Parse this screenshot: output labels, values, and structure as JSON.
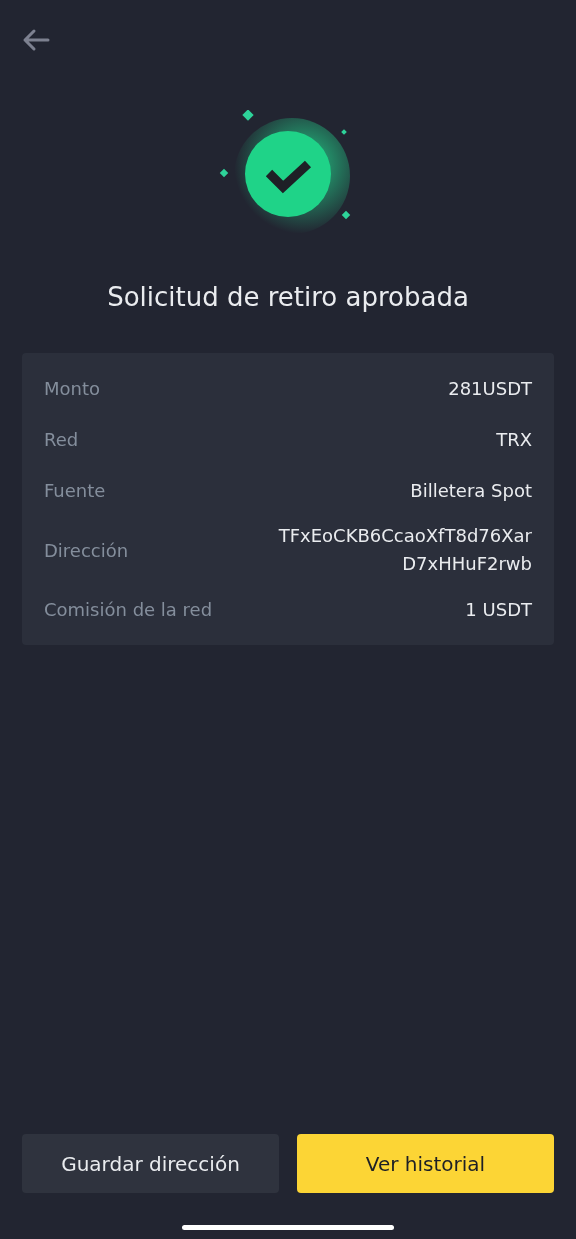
{
  "title": "Solicitud de retiro aprobada",
  "details": [
    {
      "label": "Monto",
      "value": [
        "281USDT"
      ]
    },
    {
      "label": "Red",
      "value": [
        "TRX"
      ]
    },
    {
      "label": "Fuente",
      "value": [
        "Billetera Spot"
      ]
    },
    {
      "label": "Dirección",
      "value": [
        "TFxEoCKB6CcaoXfT8d76Xar",
        "D7xHHuF2rwb"
      ]
    },
    {
      "label": "Comisión de la red",
      "value": [
        "1 USDT"
      ]
    }
  ],
  "buttons": [
    {
      "label": "Guardar dirección",
      "kind": "secondary"
    },
    {
      "label": "Ver historial",
      "kind": "primary"
    }
  ]
}
